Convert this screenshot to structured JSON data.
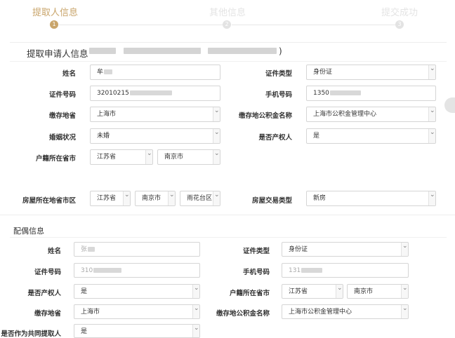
{
  "steps": [
    {
      "label": "提取人信息",
      "number": "1",
      "state": "active"
    },
    {
      "label": "其他信息",
      "number": "2",
      "state": "inactive"
    },
    {
      "label": "提交成功",
      "number": "3",
      "state": "inactive"
    }
  ],
  "applicant": {
    "title": "提取申请人信息",
    "title_suffix": ")",
    "name_label": "姓名",
    "name_value": "牟",
    "id_type_label": "证件类型",
    "id_type_value": "身份证",
    "id_no_label": "证件号码",
    "id_no_value": "32010215",
    "phone_label": "手机号码",
    "phone_value": "1350",
    "deposit_province_label": "缴存地省",
    "deposit_province_value": "上海市",
    "fund_center_label": "缴存地公积金名称",
    "fund_center_value": "上海市公积金管理中心",
    "marital_label": "婚姻状况",
    "marital_value": "未婚",
    "owner_label": "是否产权人",
    "owner_value": "是",
    "hukou_label": "户籍所在省市",
    "hukou_province": "江苏省",
    "hukou_city": "南京市",
    "house_location_label": "房屋所在地省市区",
    "house_province": "江苏省",
    "house_city": "南京市",
    "house_district": "雨花台区",
    "trade_type_label": "房屋交易类型",
    "trade_type_value": "新房"
  },
  "spouse": {
    "title": "配偶信息",
    "name_label": "姓名",
    "name_value": "张",
    "id_type_label": "证件类型",
    "id_type_value": "身份证",
    "id_no_label": "证件号码",
    "id_no_value": "310",
    "phone_label": "手机号码",
    "phone_value": "131",
    "owner_label": "是否产权人",
    "owner_value": "是",
    "hukou_label": "户籍所在省市",
    "hukou_province": "江苏省",
    "hukou_city": "南京市",
    "deposit_province_label": "缴存地省",
    "deposit_province_value": "上海市",
    "fund_center_label": "缴存地公积金名称",
    "fund_center_value": "上海市公积金管理中心",
    "co_withdraw_label": "是否作为共同提取人",
    "co_withdraw_value": "是"
  },
  "colors": {
    "accent": "#c9a56b",
    "border": "#d5d5d5"
  }
}
